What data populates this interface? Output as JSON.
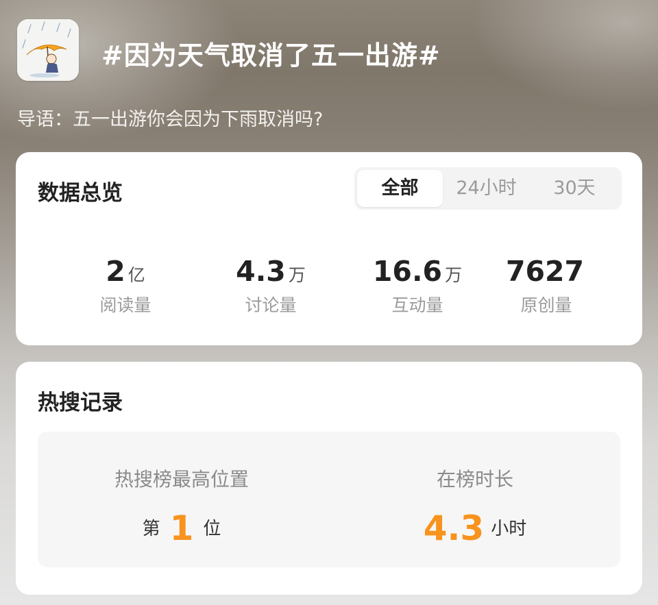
{
  "topic": {
    "title": "#因为天气取消了五一出游#",
    "guide": "导语：五一出游你会因为下雨取消吗?"
  },
  "overview": {
    "title": "数据总览",
    "tabs": [
      {
        "label": "全部",
        "selected": true
      },
      {
        "label": "24小时",
        "selected": false
      },
      {
        "label": "30天",
        "selected": false
      }
    ],
    "stats": [
      {
        "value": "2",
        "unit": "亿",
        "label": "阅读量"
      },
      {
        "value": "4.3",
        "unit": "万",
        "label": "讨论量"
      },
      {
        "value": "16.6",
        "unit": "万",
        "label": "互动量"
      },
      {
        "value": "7627",
        "unit": "",
        "label": "原创量"
      }
    ]
  },
  "hot_search": {
    "title": "热搜记录",
    "rank": {
      "label": "热搜榜最高位置",
      "prefix": "第",
      "value": "1",
      "suffix": "位"
    },
    "duration": {
      "label": "在榜时长",
      "value": "4.3",
      "unit": "小时"
    }
  },
  "colors": {
    "accent": "#f7931e",
    "card_background": "#ffffff",
    "panel_background": "#f6f6f6"
  },
  "icons": {
    "topic_avatar": "umbrella-rain-illustration-icon"
  }
}
